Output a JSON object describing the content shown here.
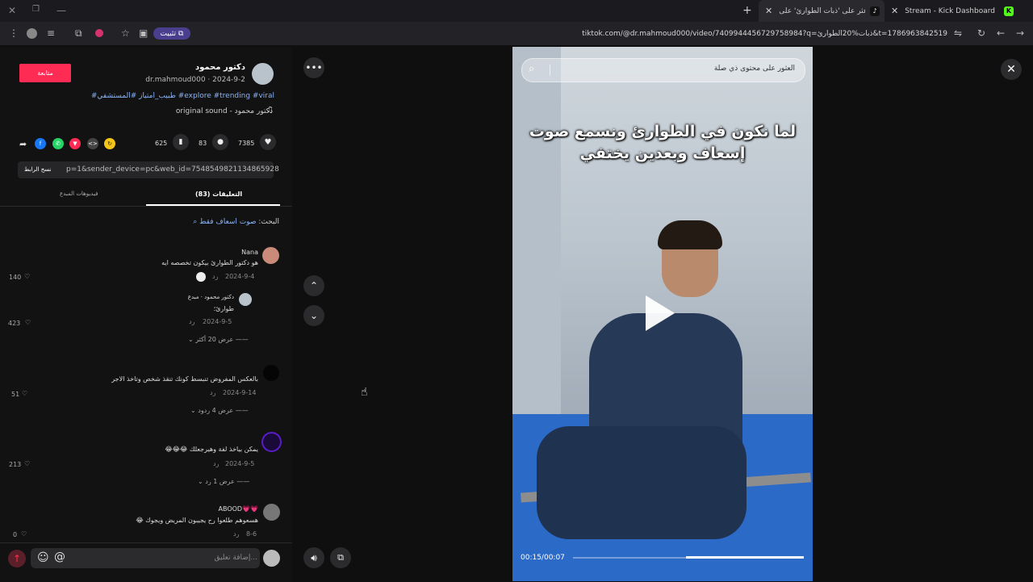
{
  "browser": {
    "tabs": [
      {
        "title": "Stream - Kick Dashboard",
        "icon": "K"
      },
      {
        "title": "اعثر على 'ذبات الطوارئ' على Tok",
        "icon": "♪"
      }
    ],
    "new_tab": "+",
    "url": "tiktok.com/@dr.mahmoud000/video/7409944456729758984?q=ذبات%20الطوارئ&t=1786963842519",
    "pin_label": "تثبيت"
  },
  "post": {
    "author_name": "دكتور محمود",
    "author_meta": "dr.mahmoud000 · 2024-9-2",
    "follow_label": "متابعة",
    "hashtags": "#طبيب_امتياز #المستشفي #explore #trending #viral",
    "sound": "original sound - دكتور محمود",
    "stats": {
      "likes": "7385",
      "comments": "83",
      "saves": "625"
    },
    "link": "p=1&sender_device=pc&web_id=7548549821134865928",
    "copy_link": "نسخ الرابط"
  },
  "tabs": {
    "comments": "التعليقات (83)",
    "creator_videos": "فيديوهات المبدع"
  },
  "search_line": {
    "prefix": "البحث:",
    "query": "صوت اسعاف فقط"
  },
  "comments": [
    {
      "user": "Nana",
      "text": "هو دكتور الطوارئ بيكون تخصصه ايه",
      "date": "2024-9-4",
      "reply": "رد",
      "likes": "140"
    },
    {
      "user": "دكتور محمود · مبدع",
      "text": "طوارئ؛",
      "date": "2024-9-5",
      "reply": "رد",
      "likes": "423",
      "more": "عرض 20 أكثر"
    },
    {
      "user": "",
      "text": "بالعكس المفروض تنبسط كونك تنقذ شخص وتاخذ الاجر",
      "date": "2024-9-14",
      "reply": "رد",
      "likes": "51",
      "more": "عرض 4 ردود"
    },
    {
      "user": "",
      "text": "يمكن بياخذ لفة وهيرجعلك 😂😂😂",
      "date": "2024-9-5",
      "reply": "رد",
      "likes": "213",
      "more": "عرض 1 رد"
    },
    {
      "user": "ABOOD💗💗",
      "text": "هسعوهم طلعوا رح يجيبون المريض ويجوك 😂",
      "date": "8-6",
      "reply": "رد",
      "likes": "0"
    }
  ],
  "comment_input": {
    "placeholder": "إضافة تعليق..."
  },
  "video": {
    "search_placeholder": "العثور على محتوى ذي صلة",
    "caption_line1": "لما نكون في الطوارئ ونسمع صوت",
    "caption_line2": "إسعاف وبعدين يختفي",
    "time": "00:15/00:07",
    "progress": 0.51
  },
  "colors": {
    "accent": "#fe2c55",
    "link": "#8ab4f8"
  }
}
